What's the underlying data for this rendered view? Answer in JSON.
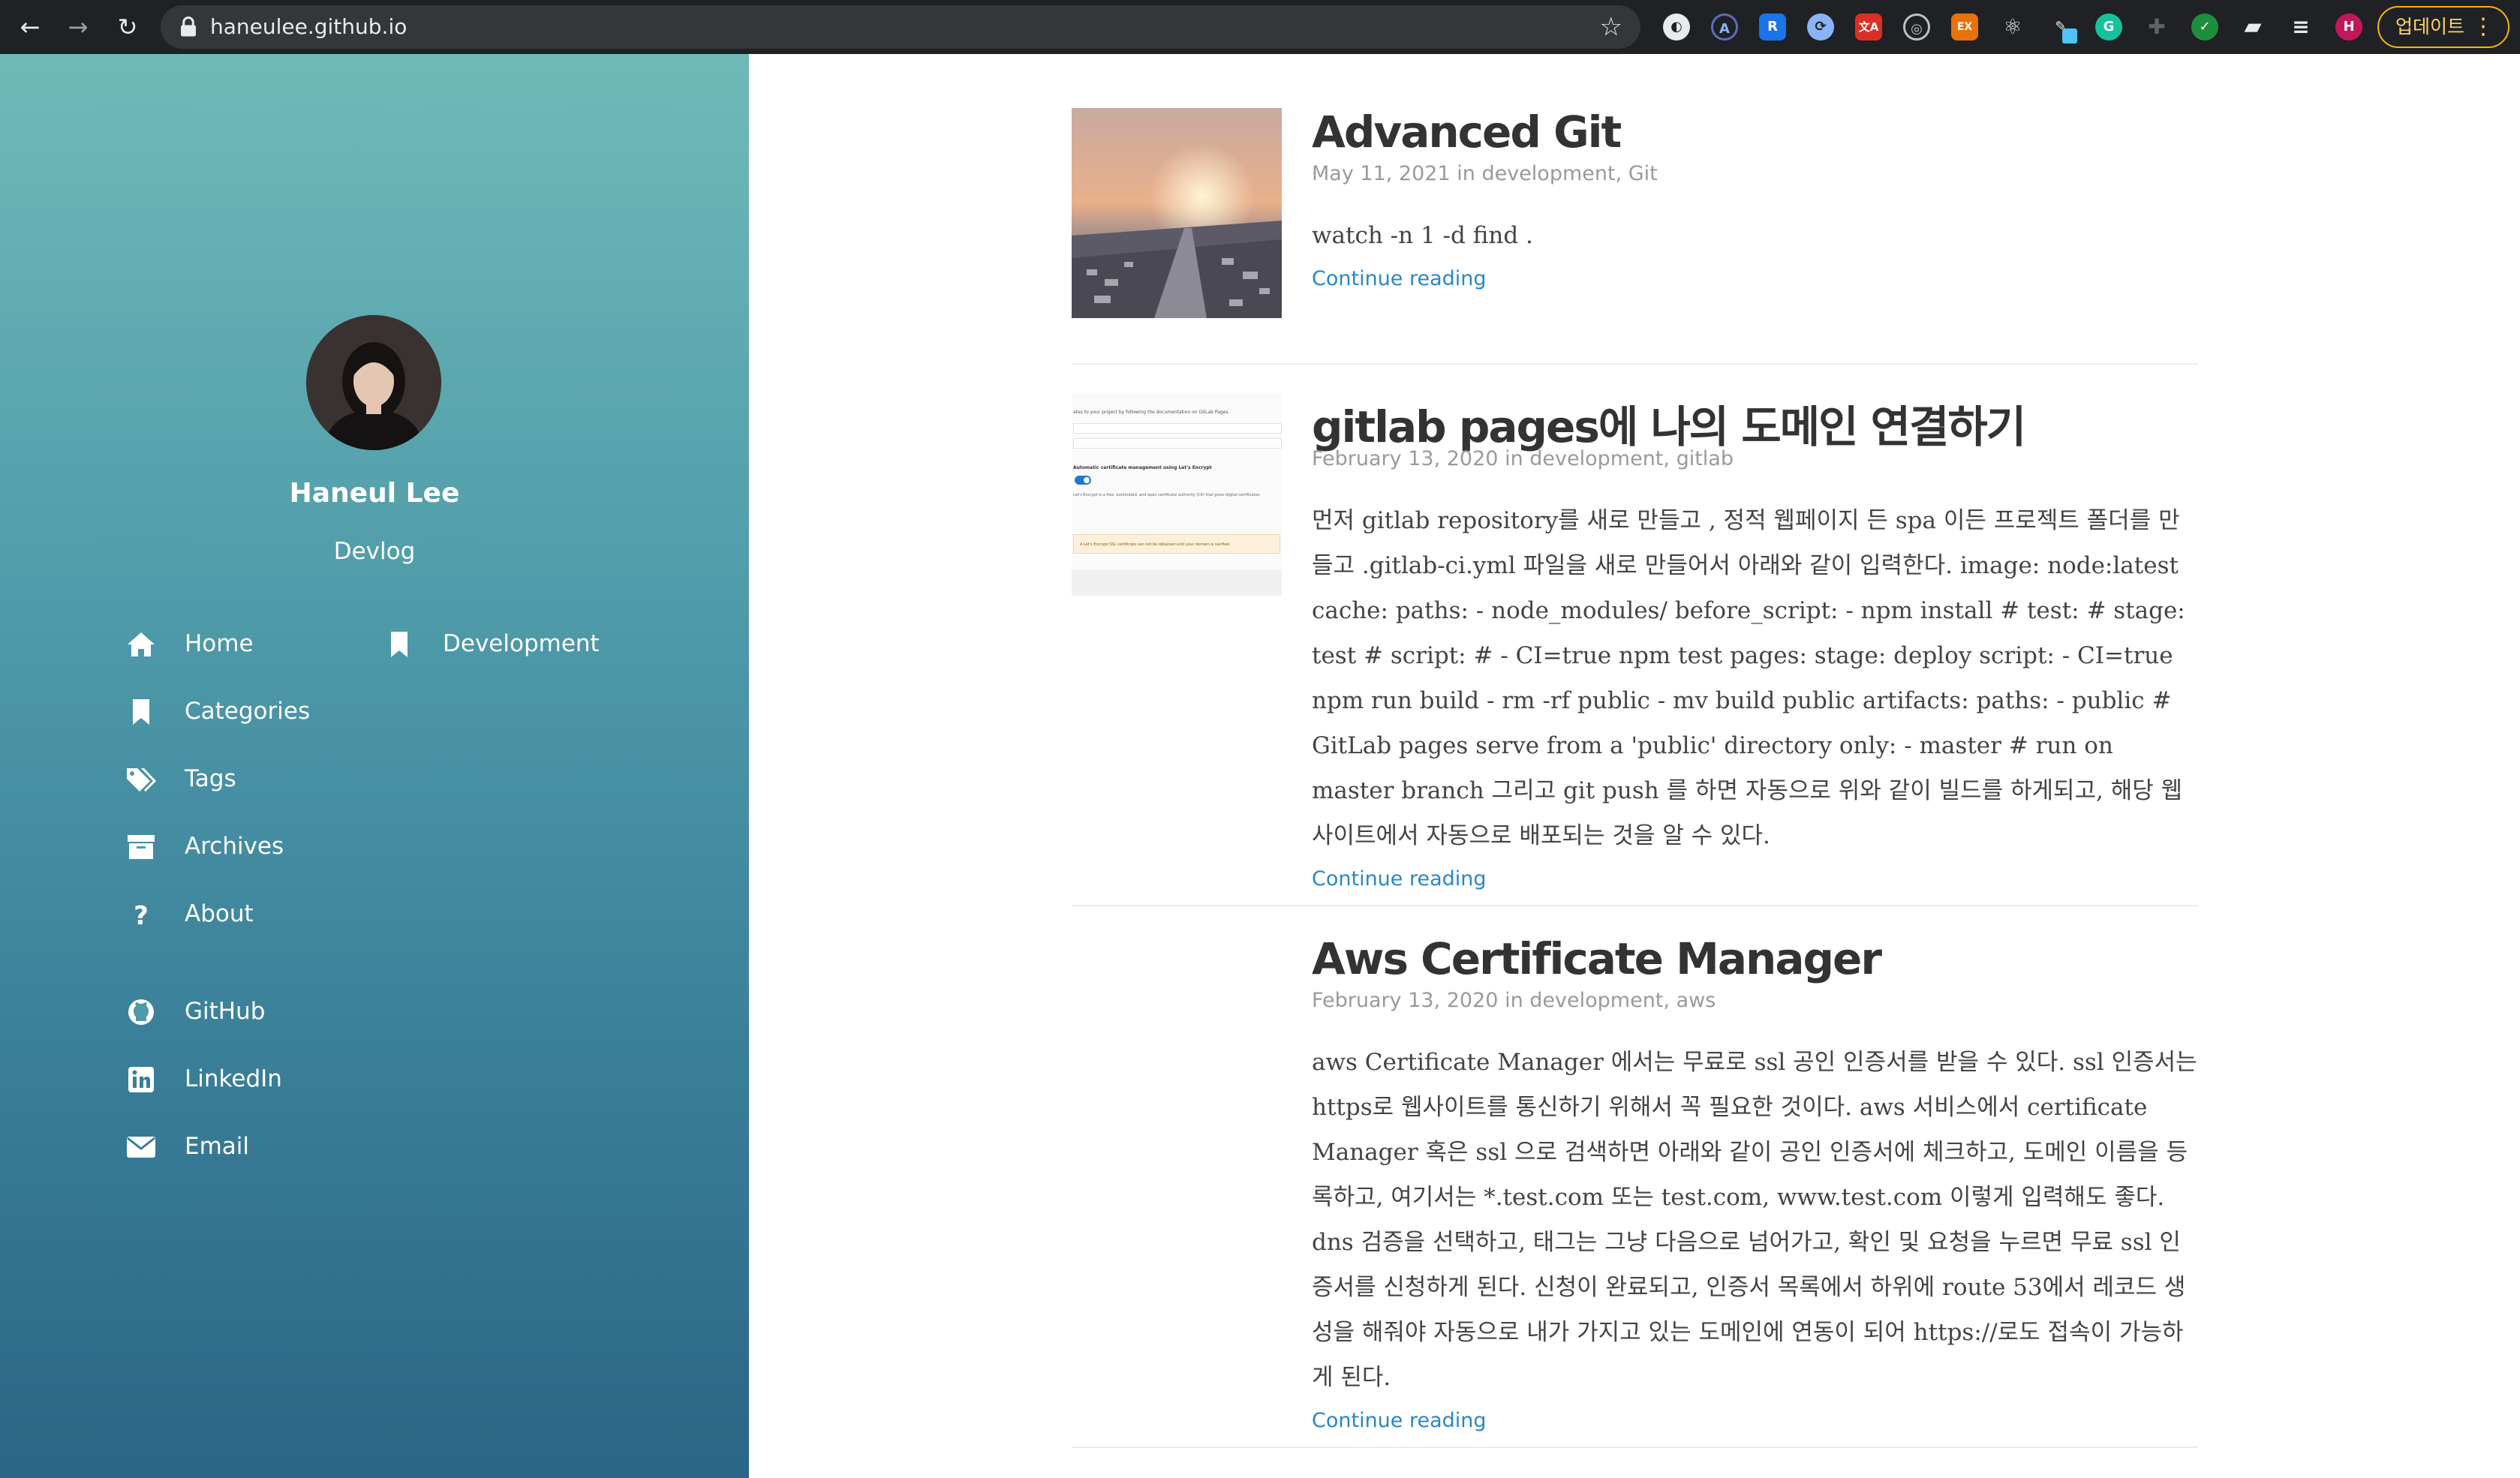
{
  "browser": {
    "url": "haneulee.github.io",
    "profile_initial": "H",
    "update_label": "업데이트",
    "extensions": [
      "globe-icon",
      "a-icon",
      "r-icon",
      "sync-icon",
      "translate-icon",
      "target-icon",
      "ex-icon",
      "react-icon",
      "pen-icon",
      "grammarly-icon",
      "crosshair-icon",
      "check-icon",
      "puzzle-icon",
      "playlist-icon"
    ]
  },
  "sidebar": {
    "author_name": "Haneul Lee",
    "author_desc": "Devlog",
    "nav": [
      {
        "label": "Home",
        "icon": "home-icon"
      },
      {
        "label": "Development",
        "icon": "bookmark-icon"
      },
      {
        "label": "Categories",
        "icon": "bookmark-icon"
      },
      {
        "label": "Tags",
        "icon": "tags-icon"
      },
      {
        "label": "Archives",
        "icon": "archive-icon"
      },
      {
        "label": "About",
        "icon": "question-icon"
      }
    ],
    "social": [
      {
        "label": "GitHub",
        "icon": "github-icon"
      },
      {
        "label": "LinkedIn",
        "icon": "linkedin-icon"
      },
      {
        "label": "Email",
        "icon": "envelope-icon"
      }
    ]
  },
  "posts": [
    {
      "title": "Advanced Git",
      "date": "May 11, 2021",
      "in": "in",
      "categories": [
        "development",
        "Git"
      ],
      "excerpt": "watch -n 1 -d find .",
      "read_more": "Continue reading"
    },
    {
      "title": "gitlab pages에 나의 도메인 연결하기",
      "date": "February 13, 2020",
      "in": "in",
      "categories": [
        "development",
        "gitlab"
      ],
      "excerpt": "먼저 gitlab repository를 새로 만들고 , 정적 웹페이지 든 spa 이든 프로젝트 폴더를 만들고 .gitlab-ci.yml 파일을 새로 만들어서 아래와 같이 입력한다. image: node:latest cache: paths: - node_modules/ before_script: - npm install # test: # stage: test # script: # - CI=true npm test pages: stage: deploy script: - CI=true npm run build - rm -rf public - mv build public artifacts: paths: - public # GitLab pages serve from a 'public' directory only: - master # run on master branch 그리고 git push 를 하면 자동으로 위와 같이 빌드를 하게되고, 해당 웹사이트에서 자동으로 배포되는 것을 알 수 있다.",
      "read_more": "Continue reading",
      "thumb_text": {
        "line1": "ates to your project by following the documentation on GitLab Pages.",
        "heading": "Automatic certificate management using Let's Encrypt",
        "body": "Let's Encrypt is a free, automated, and open certificate authority (CA) that gives digital certificates.",
        "warning": "A Let's Encrypt SSL certificate can not be obtained until your domain is verified."
      }
    },
    {
      "title": "Aws Certificate Manager",
      "date": "February 13, 2020",
      "in": "in",
      "categories": [
        "development",
        "aws"
      ],
      "excerpt": "aws Certificate Manager 에서는 무료로 ssl 공인 인증서를 받을 수 있다. ssl 인증서는 https로 웹사이트를 통신하기 위해서 꼭 필요한 것이다. aws 서비스에서 certificate Manager 혹은 ssl 으로 검색하면 아래와 같이 공인 인증서에 체크하고, 도메인 이름을 등록하고, 여기서는 *.test.com 또는 test.com, www.test.com 이렇게 입력해도 좋다. dns 검증을 선택하고, 태그는 그냥 다음으로 넘어가고, 확인 및 요청을 누르면 무료 ssl 인증서를 신청하게 된다. 신청이 완료되고, 인증서 목록에서 하위에 route 53에서 레코드 생성을 해줘야 자동으로 내가 가지고 있는 도메인에 연동이 되어 https://로도 접속이 가능하게 된다.",
      "read_more": "Continue reading"
    }
  ]
}
